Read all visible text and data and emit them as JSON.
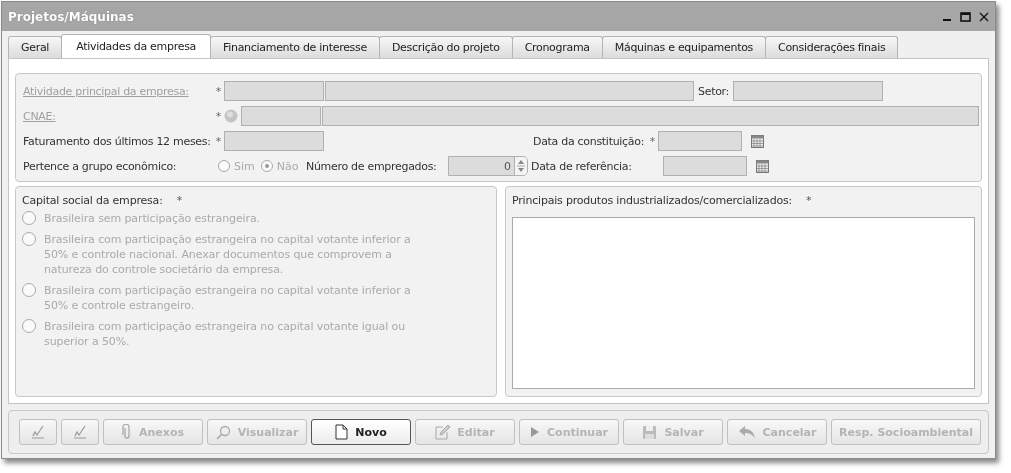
{
  "window": {
    "title": "Projetos/Máquinas"
  },
  "tabs": [
    {
      "label": "Geral",
      "selected": false
    },
    {
      "label": "Atividades da empresa",
      "selected": true
    },
    {
      "label": "Financiamento de interesse",
      "selected": false
    },
    {
      "label": "Descrição do projeto",
      "selected": false
    },
    {
      "label": "Cronograma",
      "selected": false
    },
    {
      "label": "Máquinas e equipamentos",
      "selected": false
    },
    {
      "label": "Considerações finais",
      "selected": false
    }
  ],
  "form": {
    "atividade_label": "Atividade principal da empresa:",
    "setor_label": "Setor:",
    "cnae_label": "CNAE:",
    "required_mark": "*",
    "faturamento_label": "Faturamento dos últimos 12 meses:",
    "constituicao_label": "Data da constituição:",
    "grupo_label": "Pertence a grupo econômico:",
    "grupo_options": [
      {
        "label": "Sim",
        "selected": false
      },
      {
        "label": "Não",
        "selected": true
      }
    ],
    "empregados_label": "Número de empregados:",
    "empregados_value": "0",
    "referencia_label": "Data de referência:"
  },
  "capital": {
    "label": "Capital social da empresa:",
    "required_mark": "*",
    "options": [
      {
        "label": "Brasileira sem participação estrangeira.",
        "selected": false
      },
      {
        "label": "Brasileira com participação estrangeira no capital votante inferior a 50% e controle nacional. Anexar documentos que comprovem a natureza do controle societário da empresa.",
        "selected": false
      },
      {
        "label": "Brasileira com participação estrangeira no capital votante inferior a 50% e controle estrangeiro.",
        "selected": false
      },
      {
        "label": "Brasileira com participação estrangeira no capital votante igual ou superior a 50%.",
        "selected": false
      }
    ]
  },
  "produtos": {
    "label": "Principais produtos industrializados/comercializados:",
    "required_mark": "*"
  },
  "toolbar": [
    {
      "kind": "icon",
      "disabled": true
    },
    {
      "kind": "icon",
      "disabled": true
    },
    {
      "kind": "labeled",
      "label": "Anexos",
      "disabled": true
    },
    {
      "kind": "labeled",
      "label": "Visualizar",
      "disabled": true
    },
    {
      "kind": "labeled",
      "label": "Novo",
      "disabled": false
    },
    {
      "kind": "labeled",
      "label": "Editar",
      "disabled": true
    },
    {
      "kind": "labeled",
      "label": "Continuar",
      "disabled": true
    },
    {
      "kind": "labeled",
      "label": "Salvar",
      "disabled": true
    },
    {
      "kind": "labeled",
      "label": "Cancelar",
      "disabled": true
    },
    {
      "kind": "labeled",
      "label": "Resp. Socioambiental",
      "disabled": true
    }
  ]
}
